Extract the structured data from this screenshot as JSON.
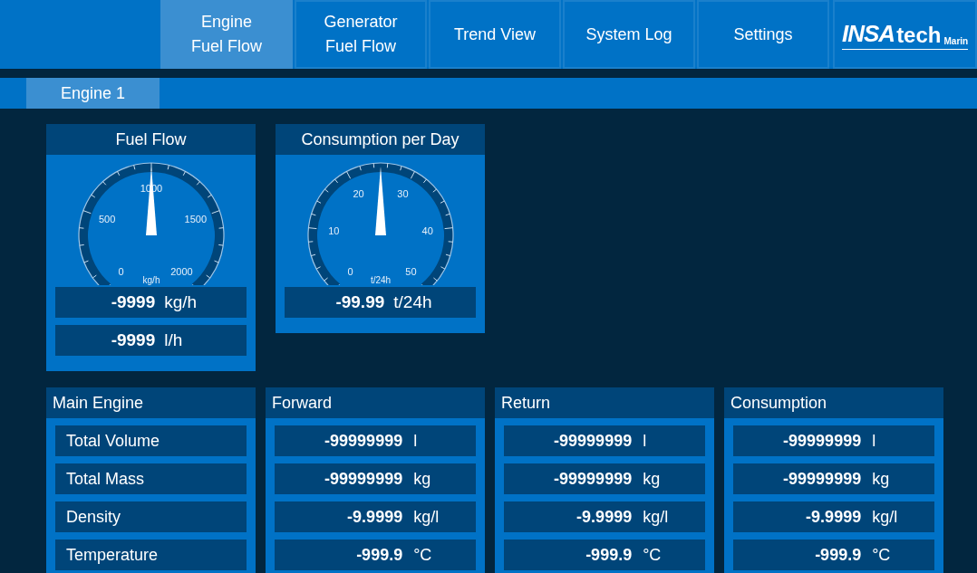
{
  "nav": {
    "tabs": [
      {
        "label": "Engine\nFuel Flow",
        "selected": true
      },
      {
        "label": "Generator\nFuel Flow",
        "selected": false
      },
      {
        "label": "Trend View",
        "selected": false
      },
      {
        "label": "System Log",
        "selected": false
      },
      {
        "label": "Settings",
        "selected": false
      }
    ],
    "logo": {
      "brand": "INSA",
      "suffix": "tech",
      "tagline": "Marin"
    }
  },
  "subtabs": [
    {
      "label": "Engine 1",
      "selected": true
    }
  ],
  "gauges": [
    {
      "title": "Fuel Flow",
      "scale": [
        "0",
        "500",
        "1000",
        "1500",
        "2000"
      ],
      "unit": "kg/h",
      "readings": [
        {
          "value": "-9999",
          "unit": "kg/h"
        },
        {
          "value": "-9999",
          "unit": "l/h"
        }
      ]
    },
    {
      "title": "Consumption per Day",
      "scale": [
        "0",
        "10",
        "20",
        "30",
        "40",
        "50"
      ],
      "unit": "t/24h",
      "readings": [
        {
          "value": "-99.99",
          "unit": "t/24h"
        }
      ]
    }
  ],
  "table": {
    "panels": [
      {
        "title": "Main Engine",
        "kind": "labels",
        "cells": [
          {
            "label": "Total Volume"
          },
          {
            "label": "Total Mass"
          },
          {
            "label": "Density"
          },
          {
            "label": "Temperature"
          }
        ]
      },
      {
        "title": "Forward",
        "kind": "values",
        "cells": [
          {
            "value": "-99999999",
            "unit": "l"
          },
          {
            "value": "-99999999",
            "unit": "kg"
          },
          {
            "value": "-9.9999",
            "unit": "kg/l"
          },
          {
            "value": "-999.9",
            "unit": "°C"
          }
        ]
      },
      {
        "title": "Return",
        "kind": "values",
        "cells": [
          {
            "value": "-99999999",
            "unit": "l"
          },
          {
            "value": "-99999999",
            "unit": "kg"
          },
          {
            "value": "-9.9999",
            "unit": "kg/l"
          },
          {
            "value": "-999.9",
            "unit": "°C"
          }
        ]
      },
      {
        "title": "Consumption",
        "kind": "values",
        "cells": [
          {
            "value": "-99999999",
            "unit": "l"
          },
          {
            "value": "-99999999",
            "unit": "kg"
          },
          {
            "value": "-9.9999",
            "unit": "kg/l"
          },
          {
            "value": "-999.9",
            "unit": "°C"
          }
        ]
      }
    ]
  }
}
